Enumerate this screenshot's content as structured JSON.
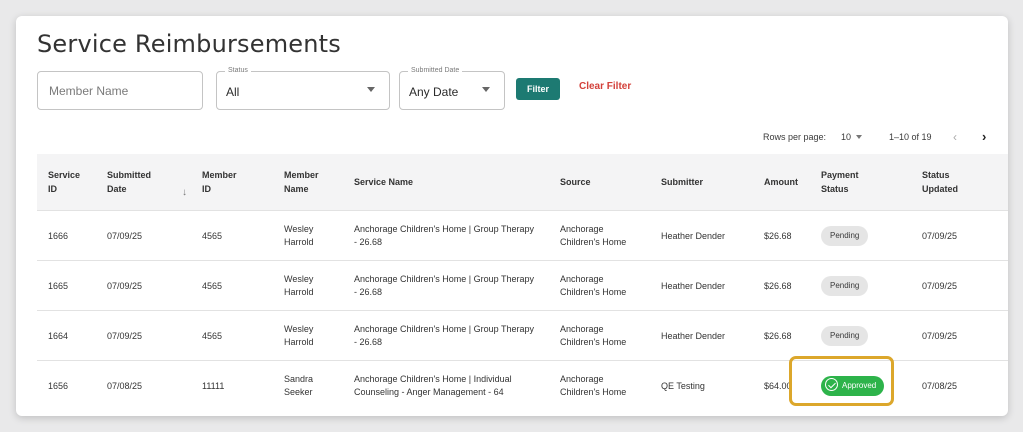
{
  "page": {
    "title": "Service Reimbursements"
  },
  "filters": {
    "member_name_placeholder": "Member Name",
    "status": {
      "label": "Status",
      "value": "All"
    },
    "submitted_date": {
      "label": "Submitted Date",
      "value": "Any Date"
    },
    "filter_label": "Filter",
    "clear_label": "Clear Filter"
  },
  "pagination": {
    "rows_per_page_label": "Rows per page:",
    "rows_per_page_value": "10",
    "range": "1–10 of 19",
    "prev_icon": "chevron-left-icon",
    "next_icon": "chevron-right-icon",
    "prev_glyph": "‹",
    "next_glyph": "›"
  },
  "table": {
    "columns": [
      {
        "l1": "Service",
        "l2": "ID"
      },
      {
        "l1": "Submitted",
        "l2": "Date"
      },
      {
        "l1": "Member",
        "l2": "ID"
      },
      {
        "l1": "Member",
        "l2": "Name"
      },
      {
        "l1": "Service Name"
      },
      {
        "l1": "Source"
      },
      {
        "l1": "Submitter"
      },
      {
        "l1": "Amount"
      },
      {
        "l1": "Payment",
        "l2": "Status"
      },
      {
        "l1": "Status",
        "l2": "Updated"
      }
    ],
    "sort_glyph": "↓",
    "rows": [
      {
        "service_id": "1666",
        "submitted_date": "07/09/25",
        "member_id": "4565",
        "member_name_1": "Wesley",
        "member_name_2": "Harrold",
        "service_name_1": "Anchorage Children's Home | Group Therapy",
        "service_name_2": "- 26.68",
        "source_1": "Anchorage",
        "source_2": "Children's Home",
        "submitter": "Heather Dender",
        "amount": "$26.68",
        "payment_status": "Pending",
        "status_updated": "07/09/25"
      },
      {
        "service_id": "1665",
        "submitted_date": "07/09/25",
        "member_id": "4565",
        "member_name_1": "Wesley",
        "member_name_2": "Harrold",
        "service_name_1": "Anchorage Children's Home | Group Therapy",
        "service_name_2": "- 26.68",
        "source_1": "Anchorage",
        "source_2": "Children's Home",
        "submitter": "Heather Dender",
        "amount": "$26.68",
        "payment_status": "Pending",
        "status_updated": "07/09/25"
      },
      {
        "service_id": "1664",
        "submitted_date": "07/09/25",
        "member_id": "4565",
        "member_name_1": "Wesley",
        "member_name_2": "Harrold",
        "service_name_1": "Anchorage Children's Home | Group Therapy",
        "service_name_2": "- 26.68",
        "source_1": "Anchorage",
        "source_2": "Children's Home",
        "submitter": "Heather Dender",
        "amount": "$26.68",
        "payment_status": "Pending",
        "status_updated": "07/09/25"
      },
      {
        "service_id": "1656",
        "submitted_date": "07/08/25",
        "member_id": "11111",
        "member_name_1": "Sandra",
        "member_name_2": "Seeker",
        "service_name_1": "Anchorage Children's Home | Individual",
        "service_name_2": "Counseling - Anger Management - 64",
        "source_1": "Anchorage",
        "source_2": "Children's Home",
        "submitter": "QE Testing",
        "amount": "$64.00",
        "payment_status": "Approved",
        "status_updated": "07/08/25"
      }
    ]
  },
  "colors": {
    "accent": "#1d7a72",
    "danger": "#d3403a",
    "approved": "#2db34a",
    "highlight": "#dca72b"
  }
}
